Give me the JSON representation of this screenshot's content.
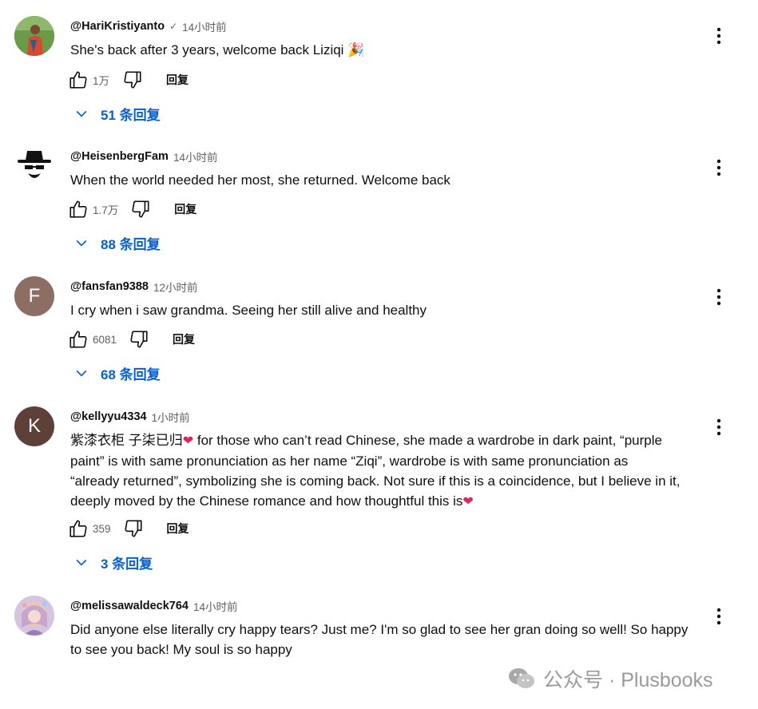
{
  "comments": [
    {
      "author": "@HariKristiyanto",
      "verified": "✓",
      "time": "14小时前",
      "lines": [
        "She's back after 3 years, welcome back Liziqi 🎉"
      ],
      "likes": "1万",
      "reply_label": "回复",
      "replies_label": "51 条回复",
      "avatar": {
        "type": "photo",
        "color": "#4a7a3a"
      }
    },
    {
      "author": "@HeisenbergFam",
      "time": "14小时前",
      "lines": [
        "When the world needed her most, she returned. Welcome back"
      ],
      "likes": "1.7万",
      "reply_label": "回复",
      "replies_label": "88 条回复",
      "avatar": {
        "type": "heisenberg",
        "color": "#ffffff"
      }
    },
    {
      "author": "@fansfan9388",
      "time": "12小时前",
      "lines": [
        "I cry when i saw grandma. Seeing her still alive and healthy"
      ],
      "likes": "6081",
      "reply_label": "回复",
      "replies_label": "68 条回复",
      "avatar": {
        "type": "letter",
        "letter": "F",
        "color": "#8d6e63"
      }
    },
    {
      "author": "@kellyyu4334",
      "time": "1小时前",
      "lines": [
        "紫漆衣柜 子柒已归",
        "paint” is with same pronunciation as her name “Ziqi”, wardrobe is with same pronunciation as",
        "“already returned”, symbolizing she is coming back. Not sure if this is a coincidence, but I believe in it,",
        "deeply moved by the Chinese romance and how thoughtful this is"
      ],
      "line1_tail": " for those who can’t read Chinese, she made a wardrobe in dark paint, “purple",
      "likes": "359",
      "reply_label": "回复",
      "replies_label": "3 条回复",
      "avatar": {
        "type": "letter",
        "letter": "K",
        "color": "#5d4037"
      }
    },
    {
      "author": "@melissawaldeck764",
      "time": "14小时前",
      "lines": [
        "Did anyone else literally cry happy tears? Just me? I'm so glad to see her gran doing so well! So happy",
        "to see you back! My soul is so happy"
      ],
      "avatar": {
        "type": "photo",
        "color": "#b8a9c9"
      }
    }
  ],
  "watermark": "公众号 · Plusbooks",
  "colors": {
    "link": "#065fd4",
    "meta": "#606060",
    "heart": "#e0245e"
  }
}
